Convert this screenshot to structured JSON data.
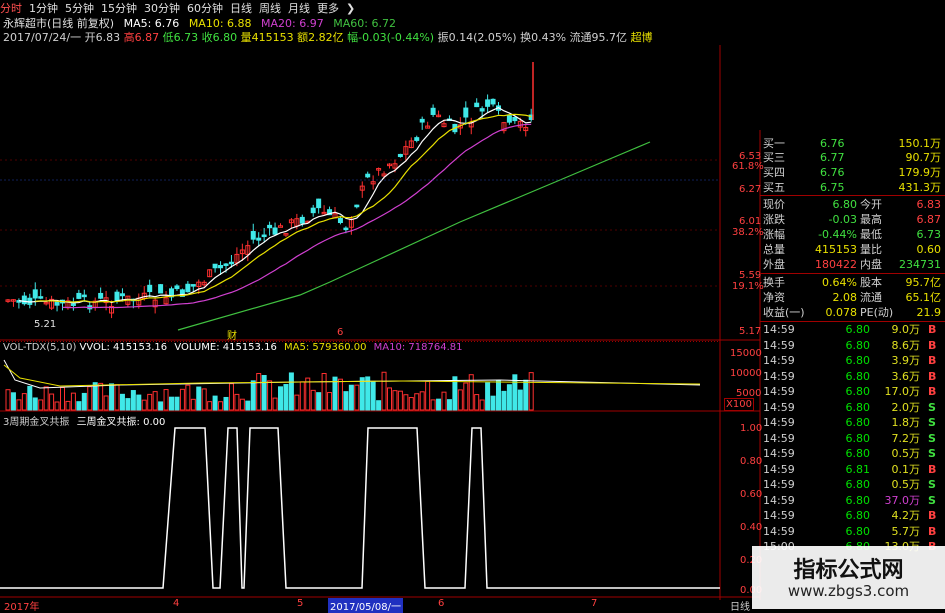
{
  "toolbar": {
    "items": [
      "分时",
      "1分钟",
      "5分钟",
      "15分钟",
      "30分钟",
      "60分钟",
      "日线",
      "周线",
      "月线",
      "更多"
    ],
    "more_icon": "chevron-right-icon"
  },
  "title_line": {
    "name": "永辉超市(日线 前复权)",
    "ma5": "MA5: 6.76",
    "ma10": "MA10: 6.88",
    "ma20": "MA20: 6.97",
    "ma60": "MA60: 6.72"
  },
  "info_line": {
    "date": "2017/07/24/一",
    "open": "开6.83",
    "high": "高6.87",
    "low": "低6.73",
    "close": "收6.80",
    "vol": "量415153",
    "amount": "额2.82亿",
    "change": "幅-0.03(-0.44%)",
    "amp": "振0.14(2.05%)",
    "turnover": "换0.43%",
    "float": "流通95.7亿",
    "extra": "超博"
  },
  "price_axis": [
    "6.53",
    "6.27",
    "6.01",
    "5.59",
    "5.17"
  ],
  "fib_labels": [
    "61.8%",
    "38.2%",
    "19.1%"
  ],
  "chart_marks": [
    "5.21",
    "财",
    "6"
  ],
  "volume_header": {
    "name": "VOL-TDX(5,10)",
    "vvol": "VVOL: 415153.16",
    "volume": "VOLUME: 415153.16",
    "ma5": "MA5: 579360.00",
    "ma10": "MA10: 718764.81"
  },
  "volume_axis": [
    "15000",
    "10000",
    "5000"
  ],
  "volume_unit": "X100",
  "indicator_header": {
    "name": "3周期金叉共振",
    "value": "三周金叉共振: 0.00"
  },
  "indicator_axis": [
    "1.00",
    "0.80",
    "0.60",
    "0.40",
    "0.20",
    "0.00"
  ],
  "date_axis": [
    "2017年",
    "4",
    "5",
    "2017/05/08/一",
    "6",
    "7"
  ],
  "date_axis_right": "日线",
  "orderbook": [
    {
      "label": "买一",
      "price": "6.76",
      "vol": "150.1万"
    },
    {
      "label": "买三",
      "price": "6.77",
      "vol": "90.7万"
    },
    {
      "label": "买四",
      "price": "6.76",
      "vol": "179.9万"
    },
    {
      "label": "买五",
      "price": "6.75",
      "vol": "431.3万"
    }
  ],
  "stats": [
    {
      "k1": "现价",
      "v1": "6.80",
      "k2": "今开",
      "v2": "6.83"
    },
    {
      "k1": "涨跌",
      "v1": "-0.03",
      "k2": "最高",
      "v2": "6.87"
    },
    {
      "k1": "涨幅",
      "v1": "-0.44%",
      "k2": "最低",
      "v2": "6.73"
    },
    {
      "k1": "总量",
      "v1": "415153",
      "k2": "量比",
      "v2": "0.60"
    },
    {
      "k1": "外盘",
      "v1": "180422",
      "k2": "内盘",
      "v2": "234731"
    },
    {
      "k1": "换手",
      "v1": "0.64%",
      "k2": "股本",
      "v2": "95.7亿"
    },
    {
      "k1": "净资",
      "v1": "2.08",
      "k2": "流通",
      "v2": "65.1亿"
    },
    {
      "k1": "收益(一)",
      "v1": "0.078",
      "k2": "PE(动)",
      "v2": "21.9"
    }
  ],
  "ticks": [
    {
      "t": "14:59",
      "p": "6.80",
      "v": "9.0万",
      "d": "B"
    },
    {
      "t": "14:59",
      "p": "6.80",
      "v": "8.6万",
      "d": "B"
    },
    {
      "t": "14:59",
      "p": "6.80",
      "v": "3.9万",
      "d": "B"
    },
    {
      "t": "14:59",
      "p": "6.80",
      "v": "3.6万",
      "d": "B"
    },
    {
      "t": "14:59",
      "p": "6.80",
      "v": "17.0万",
      "d": "B"
    },
    {
      "t": "14:59",
      "p": "6.80",
      "v": "2.0万",
      "d": "S"
    },
    {
      "t": "14:59",
      "p": "6.80",
      "v": "1.8万",
      "d": "S"
    },
    {
      "t": "14:59",
      "p": "6.80",
      "v": "7.2万",
      "d": "S"
    },
    {
      "t": "14:59",
      "p": "6.80",
      "v": "0.5万",
      "d": "S"
    },
    {
      "t": "14:59",
      "p": "6.81",
      "v": "0.1万",
      "d": "B"
    },
    {
      "t": "14:59",
      "p": "6.80",
      "v": "0.5万",
      "d": "S"
    },
    {
      "t": "14:59",
      "p": "6.80",
      "v": "37.0万",
      "d": "S"
    },
    {
      "t": "14:59",
      "p": "6.80",
      "v": "4.2万",
      "d": "B"
    },
    {
      "t": "14:59",
      "p": "6.80",
      "v": "5.7万",
      "d": "B"
    },
    {
      "t": "15:00",
      "p": "6.80",
      "v": "13.0万",
      "d": "B"
    }
  ],
  "watermark": {
    "title": "指标公式网",
    "url": "www.zbgs3.com"
  },
  "colors": {
    "up": "#ff3030",
    "down": "#40e8e8",
    "ma5": "#ffffff",
    "ma10": "#e8e000",
    "ma20": "#d040d0",
    "ma60": "#40c040",
    "grid": "#a00000"
  }
}
